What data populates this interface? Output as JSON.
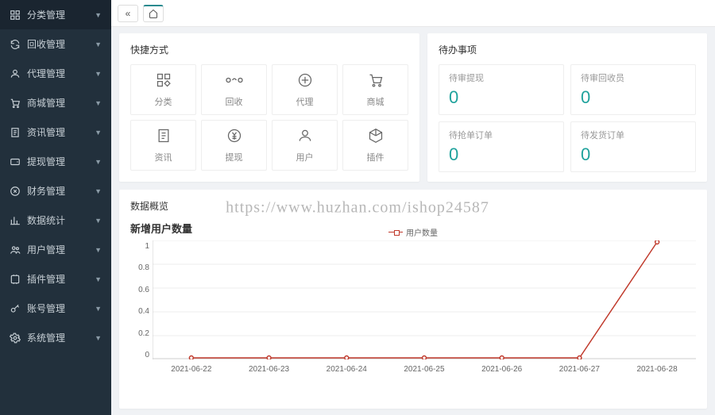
{
  "sidebar": {
    "items": [
      {
        "label": "分类管理"
      },
      {
        "label": "回收管理"
      },
      {
        "label": "代理管理"
      },
      {
        "label": "商城管理"
      },
      {
        "label": "资讯管理"
      },
      {
        "label": "提现管理"
      },
      {
        "label": "财务管理"
      },
      {
        "label": "数据统计"
      },
      {
        "label": "用户管理"
      },
      {
        "label": "插件管理"
      },
      {
        "label": "账号管理"
      },
      {
        "label": "系统管理"
      }
    ]
  },
  "panels": {
    "quick_title": "快捷方式",
    "todo_title": "待办事项",
    "data_title": "数据概览"
  },
  "quick": [
    {
      "label": "分类"
    },
    {
      "label": "回收"
    },
    {
      "label": "代理"
    },
    {
      "label": "商城"
    },
    {
      "label": "资讯"
    },
    {
      "label": "提现"
    },
    {
      "label": "用户"
    },
    {
      "label": "插件"
    }
  ],
  "todos": [
    {
      "label": "待审提现",
      "value": "0"
    },
    {
      "label": "待审回收员",
      "value": "0"
    },
    {
      "label": "待抢单订单",
      "value": "0"
    },
    {
      "label": "待发货订单",
      "value": "0"
    }
  ],
  "chart_data": {
    "type": "line",
    "title": "新增用户数量",
    "legend": "用户数量",
    "xlabel": "",
    "ylabel": "",
    "ylim": [
      0,
      1
    ],
    "yticks": [
      "1",
      "0.8",
      "0.6",
      "0.4",
      "0.2",
      "0"
    ],
    "categories": [
      "2021-06-22",
      "2021-06-23",
      "2021-06-24",
      "2021-06-25",
      "2021-06-26",
      "2021-06-27",
      "2021-06-28"
    ],
    "series": [
      {
        "name": "用户数量",
        "values": [
          0,
          0,
          0,
          0,
          0,
          0,
          1
        ],
        "color": "#c0392b"
      }
    ]
  },
  "watermark": "https://www.huzhan.com/ishop24587"
}
